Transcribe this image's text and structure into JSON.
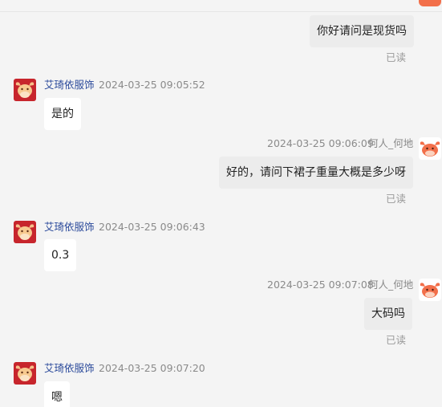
{
  "messages": [
    {
      "type": "out",
      "text": "你好请问是现货吗",
      "read": "已读"
    },
    {
      "type": "in",
      "sender": "艾琦依服饰",
      "time": "2024-03-25 09:05:52",
      "text": "是的"
    },
    {
      "type": "out",
      "sender": "何人_何地",
      "time": "2024-03-25 09:06:09",
      "text": "好的，请问下裙子重量大概是多少呀",
      "read": "已读"
    },
    {
      "type": "in",
      "sender": "艾琦依服饰",
      "time": "2024-03-25 09:06:43",
      "text": "0.3"
    },
    {
      "type": "out",
      "sender": "何人_何地",
      "time": "2024-03-25 09:07:08",
      "text": "大码吗",
      "read": "已读"
    },
    {
      "type": "in",
      "sender": "艾琦依服饰",
      "time": "2024-03-25 09:07:20",
      "text": "嗯"
    }
  ],
  "colors": {
    "shop_avatar": "#c7252c",
    "user_avatar_accent": "#f26f4a",
    "sender_name": "#2b4a9b"
  },
  "icons": {
    "shop_avatar": "ox-mascot-avatar",
    "user_avatar": "ox-cartoon-avatar"
  }
}
